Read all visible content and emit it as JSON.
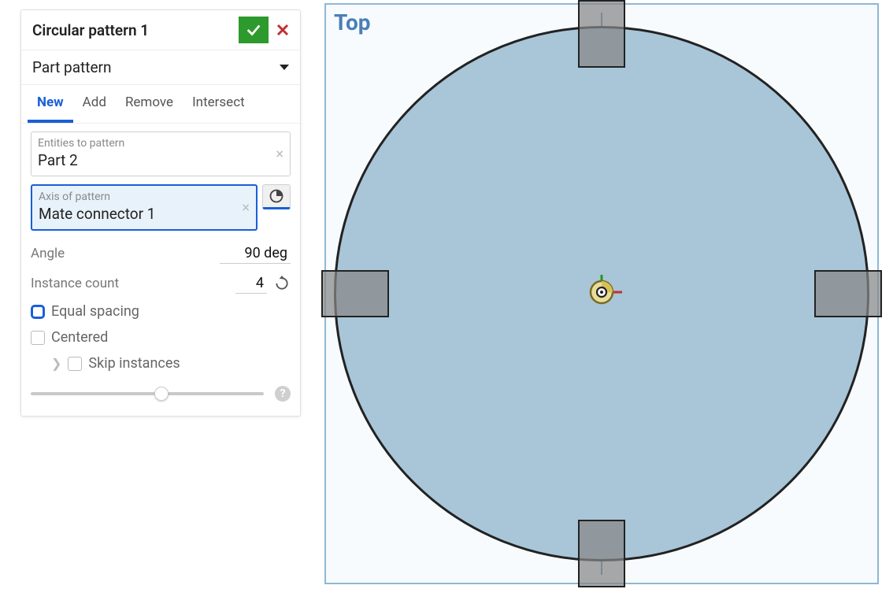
{
  "panel": {
    "title": "Circular pattern 1",
    "pattern_type": "Part pattern",
    "tabs": {
      "new": "New",
      "add": "Add",
      "remove": "Remove",
      "intersect": "Intersect",
      "active": "new"
    },
    "entities": {
      "label": "Entities to pattern",
      "value": "Part 2"
    },
    "axis": {
      "label": "Axis of pattern",
      "value": "Mate connector 1"
    },
    "angle": {
      "label": "Angle",
      "value": "90 deg"
    },
    "instances": {
      "label": "Instance count",
      "value": "4"
    },
    "equal_spacing": "Equal spacing",
    "centered": "Centered",
    "skip_instances": "Skip instances"
  },
  "viewport": {
    "label": "Top"
  }
}
